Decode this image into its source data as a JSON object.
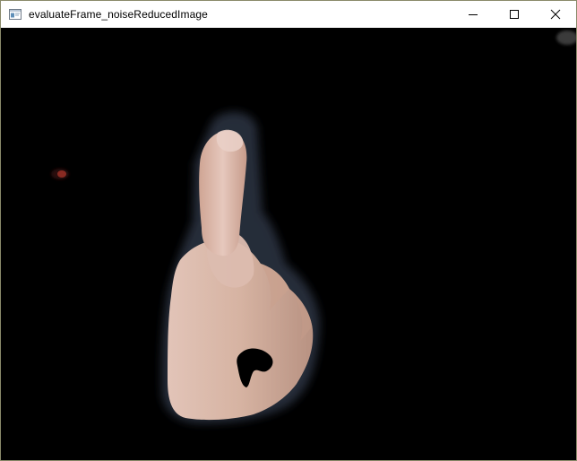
{
  "window": {
    "title": "evaluateFrame_noiseReducedImage",
    "icons": {
      "app": "app-window-icon",
      "minimize": "minimize-icon",
      "maximize": "maximize-icon",
      "close": "close-icon"
    }
  },
  "image": {
    "subject": "hand-pointing-up",
    "background_color": "#000000",
    "skin_color": "#d9b8a8"
  }
}
